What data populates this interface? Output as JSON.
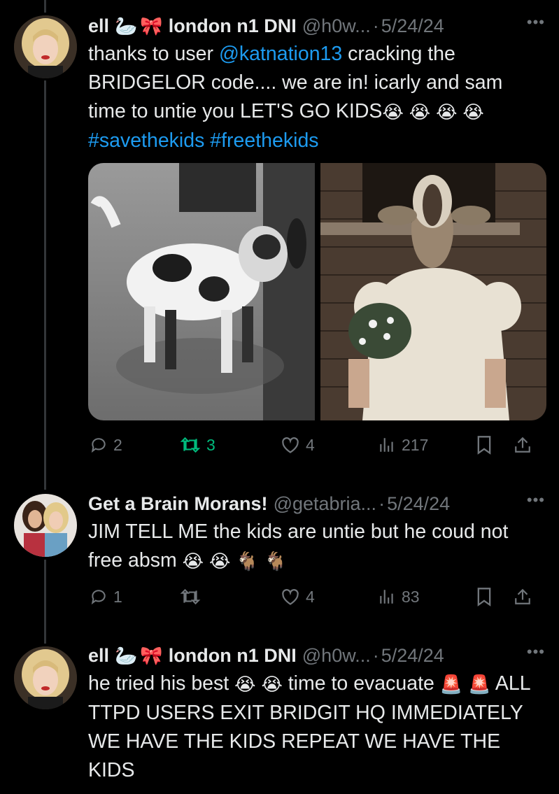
{
  "tweets": [
    {
      "name": "ell",
      "name_suffix": "london n1 DNI",
      "handle": "@h0w...",
      "date": "5/24/24",
      "text_parts": {
        "p1": "thanks to user ",
        "mention": "@katnation13",
        "p2": " cracking the BRIDGELOR code.... we are in! icarly and sam time to untie you LET'S GO KIDS",
        "hashtag1": "#savethekids",
        "hashtag2": "#freethekids"
      },
      "emojis": [
        "😭",
        "😭",
        "😭",
        "😭"
      ],
      "name_emojis": [
        "🦢",
        "🎀"
      ],
      "stats": {
        "replies": "2",
        "retweets": "3",
        "likes": "4",
        "views": "217"
      }
    },
    {
      "name": "Get a Brain Morans!",
      "handle": "@getabria...",
      "date": "5/24/24",
      "text": "JIM TELL ME the kids are untie but he coud not free absm",
      "emojis": [
        "😭",
        "😭",
        "🐐",
        "🐐"
      ],
      "stats": {
        "replies": "1",
        "retweets": "",
        "likes": "4",
        "views": "83"
      }
    },
    {
      "name": "ell",
      "name_suffix": "london n1 DNI",
      "handle": "@h0w...",
      "date": "5/24/24",
      "text_a": "he tried his best",
      "text_b": "time to evacuate",
      "text_c": "ALL TTPD USERS EXIT BRIDGIT HQ IMMEDIATELY WE HAVE THE KIDS REPEAT WE HAVE THE KIDS",
      "emojis": [
        "😭",
        "😭",
        "🚨",
        "🚨"
      ],
      "name_emojis": [
        "🦢",
        "🎀"
      ]
    }
  ],
  "icons": {
    "more": "more-options-icon",
    "reply": "reply-icon",
    "retweet": "retweet-icon",
    "like": "like-icon",
    "views": "views-icon",
    "bookmark": "bookmark-icon",
    "share": "share-icon"
  },
  "colors": {
    "link": "#1d9bf0",
    "muted": "#71767b",
    "retweet_active": "#00ba7c",
    "bg": "#000000"
  }
}
